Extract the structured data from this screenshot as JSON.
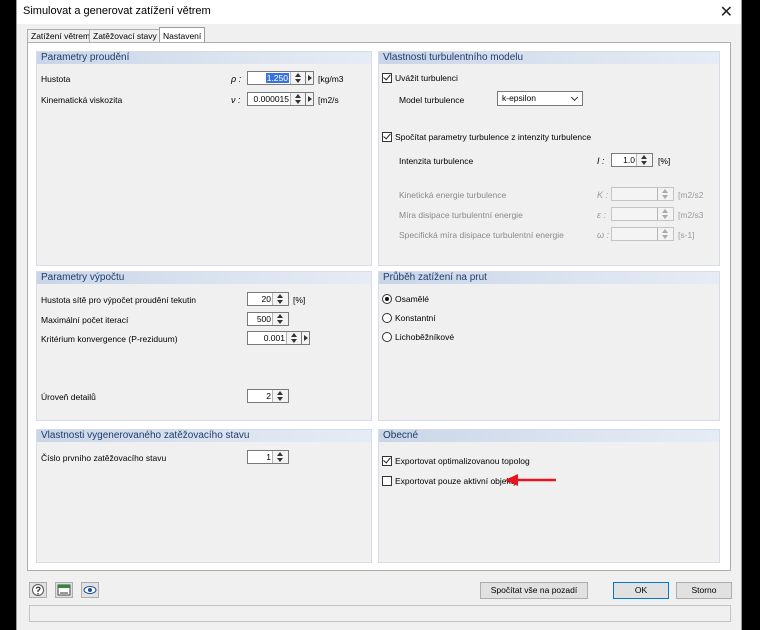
{
  "window": {
    "title": "Simulovat a generovat zatížení větrem",
    "close_glyph": "✕"
  },
  "tabs": [
    {
      "label": "Zatížení větrem"
    },
    {
      "label": "Zatěžovací stavy"
    },
    {
      "label": "Nastavení"
    }
  ],
  "flow": {
    "header": "Parametry proudění",
    "density": {
      "label": "Hustota",
      "symbol": "ρ :",
      "value": "1.250",
      "unit": "[kg/m3"
    },
    "viscosity": {
      "label": "Kinematická viskozita",
      "symbol": "ν :",
      "value": "0.000015",
      "unit": "[m2/s"
    }
  },
  "turb": {
    "header": "Vlastnosti turbulentního modelu",
    "consider_label": "Uvážit turbulenci",
    "model_label": "Model turbulence",
    "model_value": "k-epsilon",
    "compute_label": "Spočítat parametry turbulence z intenzity turbulence",
    "intensity": {
      "label": "Intenzita turbulence",
      "symbol": "I :",
      "value": "1.0",
      "unit": "[%]"
    },
    "kinetic": {
      "label": "Kinetická energie turbulence",
      "symbol": "K :",
      "unit": "[m2/s2"
    },
    "dissipation": {
      "label": "Míra disipace turbulentní energie",
      "symbol": "ε :",
      "unit": "[m2/s3"
    },
    "specific": {
      "label": "Specifická míra disipace turbulentní energie",
      "symbol": "ω :",
      "unit": "[s-1]"
    }
  },
  "calc": {
    "header": "Parametry výpočtu",
    "mesh": {
      "label": "Hustota sítě pro výpočet proudění tekutin",
      "value": "20",
      "unit": "[%]"
    },
    "iterations": {
      "label": "Maximální počet iterací",
      "value": "500"
    },
    "convergence": {
      "label": "Kritérium konvergence (P-reziduum)",
      "value": "0.001"
    },
    "detail": {
      "label": "Úroveň detailů",
      "value": "2"
    }
  },
  "progress": {
    "header": "Průběh zatížení na prut",
    "options": [
      "Osamělé",
      "Konstantní",
      "Lichoběžníkové"
    ]
  },
  "lc": {
    "header": "Vlastnosti vygenerovaného zatěžovacího stavu",
    "first": {
      "label": "Číslo prvního zatěžovacího stavu",
      "value": "1"
    }
  },
  "general": {
    "header": "Obecné",
    "export_topo": "Exportovat optimalizovanou topolog",
    "export_active": "Exportovat pouze aktivní objekty"
  },
  "footer": {
    "calc_bg": "Spočítat vše na pozadí",
    "ok": "OK",
    "cancel": "Storno"
  },
  "colors": {
    "annotation_arrow": "#e8141e",
    "group_header_text": "#1f3c6a"
  }
}
